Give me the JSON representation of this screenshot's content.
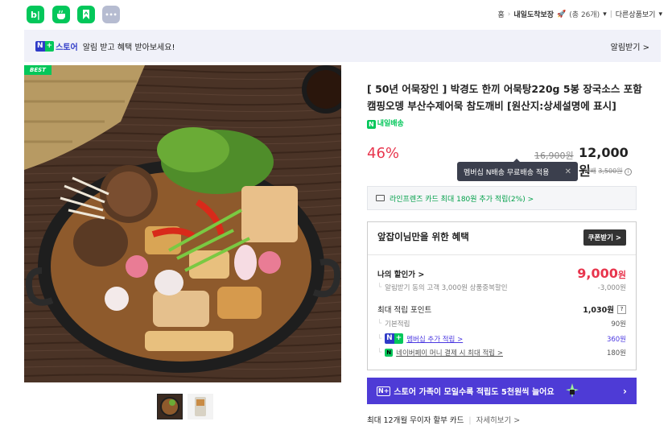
{
  "topbar": {
    "app_icons": [
      {
        "name": "blog-icon",
        "label": "b|",
        "color": "#03c75a"
      },
      {
        "name": "cafe-icon",
        "label": "",
        "color": "#03c75a"
      },
      {
        "name": "bookmark-icon",
        "label": "",
        "color": "#03c75a"
      },
      {
        "name": "more-apps-icon",
        "label": "•••",
        "color": "#b6bcd1"
      }
    ],
    "breadcrumb": {
      "home": "홈",
      "category": "내일도착보장",
      "count": "(총 26개)",
      "other": "다른상품보기"
    }
  },
  "banner": {
    "badge_n": "N",
    "badge_plus": "+",
    "store": "스토어",
    "message": "알림 받고 혜택 받아보세요!",
    "action": "알림받기 >"
  },
  "image": {
    "best_label": "BEST"
  },
  "product": {
    "title": "[ 50년 어묵장인 ] 박경도 한끼 어묵탕220g 5봉 장국소스 포함 캠핑오뎅 부산수제어묵 참도깨비 [원산지:상세설명에 표시]",
    "delivery_tag": "내일배송",
    "discount": "46%",
    "original_price": "16,900원",
    "price": "12,000원",
    "tooltip": "멤버십 N배송 무료배송 적용",
    "tooltip_close": "✕",
    "shipping_label": "택배",
    "shipping_original": "3,500원",
    "card_offer": "라인프렌즈 카드 최대 180원 추가 적립(2%) >"
  },
  "benefit": {
    "heading": "앞잡이님만을 위한 혜택",
    "coupon_button": "쿠폰받기 >",
    "my_discount_label": "나의 할인가 >",
    "my_discount_value": "9,000",
    "my_discount_unit": "원",
    "alert_discount_label": "알림받기 동의 고객 3,000원 상품중복할인",
    "alert_discount_value": "-3,000원",
    "points_label": "최대 적립 포인트",
    "points_value": "1,030원",
    "points_help": "?",
    "basic_label": "기본적립",
    "basic_value": "90원",
    "membership_label": "멤버십 추가 적립 >",
    "membership_value": "360원",
    "naverpay_label": "네이버페이 머니 결제 시 최대 적립 >",
    "naverpay_value": "180원"
  },
  "promo": {
    "text": "스토어 가족이 모일수록 적립도 5천원씩 늘어요",
    "arrow": "›"
  },
  "installment": {
    "text": "최대 12개월 무이자 할부 카드",
    "more": "자세히보기 >"
  },
  "colors": {
    "naver_green": "#03c75a",
    "naver_blue": "#2e3ac7",
    "sale_red": "#e8354d",
    "membership_purple": "#4e3bd6"
  }
}
